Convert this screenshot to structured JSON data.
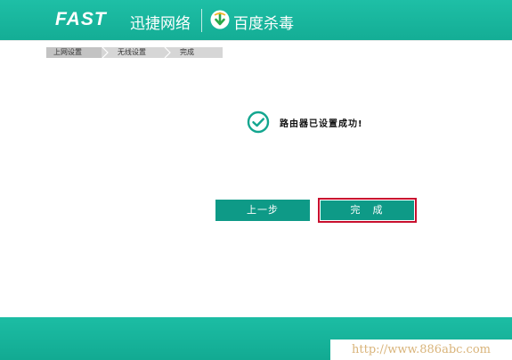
{
  "header": {
    "brand": "FAST",
    "brand_cn": "迅捷网络",
    "partner": "百度杀毒",
    "partner_icon": "baidu-shield-icon"
  },
  "breadcrumb": {
    "items": [
      "上网设置",
      "无线设置",
      "完成"
    ]
  },
  "status": {
    "icon": "check-circle-icon",
    "message": "路由器已设置成功!"
  },
  "buttons": {
    "prev": "上一步",
    "done": "完成"
  },
  "footer": {
    "watermark": "http://www.886abc.com"
  },
  "colors": {
    "brand_teal": "#1ebfa6",
    "button_teal": "#0e9a87",
    "highlight_red": "#c8102e"
  }
}
